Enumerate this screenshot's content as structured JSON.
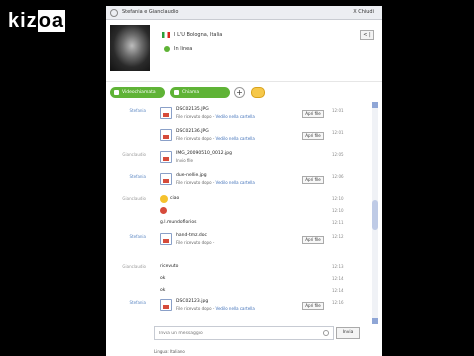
{
  "brand": {
    "logo_start": "kiz",
    "logo_box": "oa"
  },
  "window": {
    "title": "Stefania e Gianclaudio",
    "close_label": "X Chiudi"
  },
  "profile": {
    "location": "I L'U Bologna, Italia",
    "status": "In linea",
    "button_label": "< |",
    "status_color": "#5fb336"
  },
  "actions": {
    "video_call_label": "Videochiamata",
    "call_label": "Chiama",
    "add_label": "+"
  },
  "messages": [
    {
      "kind": "file",
      "sender": "Stefania",
      "name": "DSC02135.JPG",
      "info": "File ricevuto dopo -",
      "link": "Vedilo nella cartella",
      "save": "Apri file",
      "time": "12:01"
    },
    {
      "kind": "file",
      "sender": "",
      "name": "DSC02136.JPG",
      "info": "File ricevuto dopo -",
      "link": "Vedilo nella cartella",
      "save": "Apri file",
      "time": "12:01"
    },
    {
      "kind": "file",
      "sender": "Gianclaudio",
      "name": "IMG_20090510_0012.jpg",
      "info": "Invio file",
      "link": "",
      "save": "",
      "time": "12:05"
    },
    {
      "kind": "file",
      "sender": "Stefania",
      "name": "due-nellie.jpg",
      "info": "File ricevuto dopo -",
      "link": "Vedilo nella cartella",
      "save": "Apri file",
      "time": "12:06"
    },
    {
      "kind": "smiley",
      "sender": "Gianclaudio",
      "text": "ciao",
      "time": "12:10"
    },
    {
      "kind": "red",
      "sender": "",
      "text": "",
      "time": "12:10"
    },
    {
      "kind": "text",
      "sender": "",
      "text": "g.l.mundoflorios",
      "time": "12:11"
    },
    {
      "kind": "file",
      "sender": "Stefania",
      "name": "hand-tmz.doc",
      "info": "File ricevuto dopo -",
      "link": "",
      "save": "Apri file",
      "time": "12:12"
    },
    {
      "kind": "text",
      "sender": "Gianclaudio",
      "text": "ricevuto",
      "time": "12:13"
    },
    {
      "kind": "text",
      "sender": "",
      "text": "ok",
      "time": "12:14"
    },
    {
      "kind": "text",
      "sender": "",
      "text": "ok",
      "time": "12:14"
    },
    {
      "kind": "file",
      "sender": "Stefania",
      "name": "DSC02123.jpg",
      "info": "File ricevuto dopo -",
      "link": "Vedilo nella cartella",
      "save": "Apri file",
      "time": "12:16"
    }
  ],
  "composer": {
    "placeholder": "Invia un messaggio",
    "send_label": "Invia"
  },
  "footer": {
    "language": "Lingua: Italiano"
  }
}
